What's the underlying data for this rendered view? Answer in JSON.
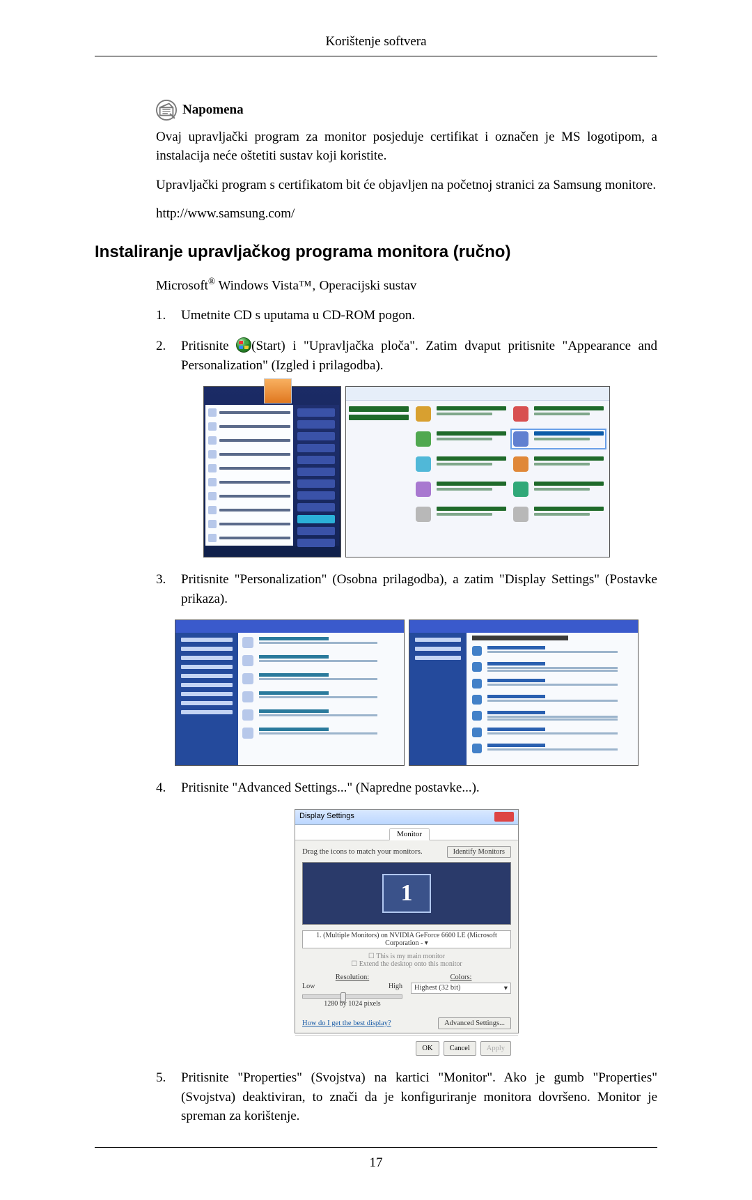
{
  "running_head": "Korištenje softvera",
  "note": {
    "label": "Napomena",
    "p1": "Ovaj upravljački program za monitor posjeduje certifikat i označen je MS logotipom, a instalacija neće oštetiti sustav koji koristite.",
    "p2": "Upravljački program s certifikatom bit će objavljen na početnoj stranici za Samsung monitore.",
    "p3": "http://www.samsung.com/"
  },
  "section_title": "Instaliranje upravljačkog programa monitora (ručno)",
  "subhead_prefix": "Microsoft",
  "subhead_reg": "®",
  "subhead_mid": " Windows Vista™‚ Operacijski sustav",
  "steps": {
    "s1": {
      "num": "1.",
      "text": "Umetnite CD s uputama u CD-ROM pogon."
    },
    "s2": {
      "num": "2.",
      "pre": "Pritisnite ",
      "post": "(Start) i \"Upravljačka ploča\". Zatim dvaput pritisnite \"Appearance and Personalization\" (Izgled i prilagodba)."
    },
    "s3": {
      "num": "3.",
      "text": "Pritisnite \"Personalization\" (Osobna prilagodba), a zatim \"Display Settings\" (Postavke prikaza)."
    },
    "s4": {
      "num": "4.",
      "text": "Pritisnite \"Advanced Settings...\" (Napredne postavke...)."
    },
    "s5": {
      "num": "5.",
      "text": "Pritisnite \"Properties\" (Svojstva) na kartici \"Monitor\". Ako je gumb \"Properties\" (Svojstva) deaktiviran, to znači da je konfiguriranje monitora dovršeno. Monitor je spreman za korištenje."
    }
  },
  "dispset": {
    "title": "Display Settings",
    "tab": "Monitor",
    "drag": "Drag the icons to match your monitors.",
    "identify": "Identify Monitors",
    "mon_num": "1",
    "combo": "1. (Multiple Monitors) on NVIDIA GeForce 6600 LE (Microsoft Corporation - ▾",
    "chk1": "This is my main monitor",
    "chk2": "Extend the desktop onto this monitor",
    "res_label": "Resolution:",
    "low": "Low",
    "high": "High",
    "res_val": "1280 by 1024 pixels",
    "colors_label": "Colors:",
    "colors_val": "Highest (32 bit)",
    "help": "How do I get the best display?",
    "adv": "Advanced Settings...",
    "ok": "OK",
    "cancel": "Cancel",
    "apply": "Apply"
  },
  "page_number": "17"
}
